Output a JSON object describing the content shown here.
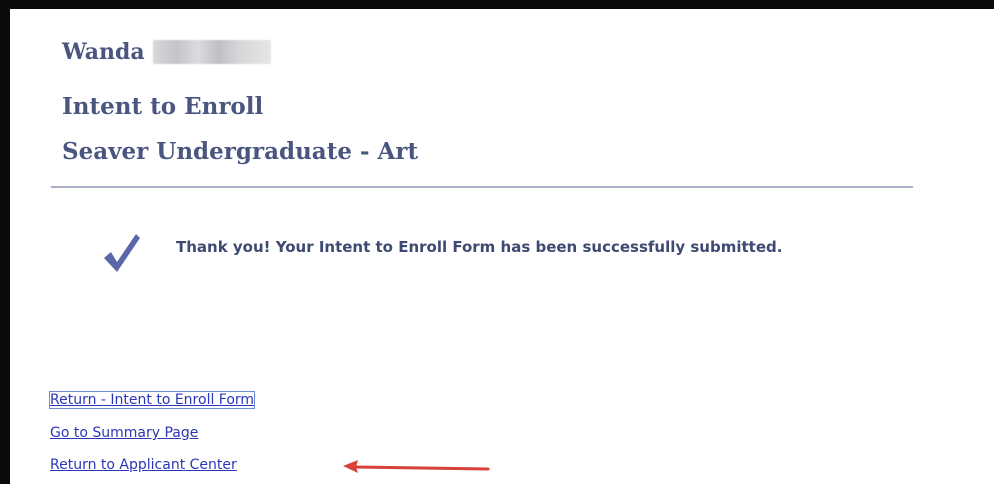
{
  "header": {
    "user_first_name": "Wanda",
    "title": "Intent to Enroll",
    "program": "Seaver Undergraduate - Art"
  },
  "confirmation": {
    "icon": "checkmark-icon",
    "message": "Thank you! Your Intent to Enroll Form has been successfully submitted."
  },
  "links": [
    {
      "label": "Return - Intent to Enroll Form"
    },
    {
      "label": "Go to Summary Page"
    },
    {
      "label": "Return to Applicant Center"
    }
  ],
  "colors": {
    "heading": "#4a5680",
    "link": "#2b37b8",
    "check": "#5b67a8",
    "annotation_arrow": "#d9413b"
  }
}
